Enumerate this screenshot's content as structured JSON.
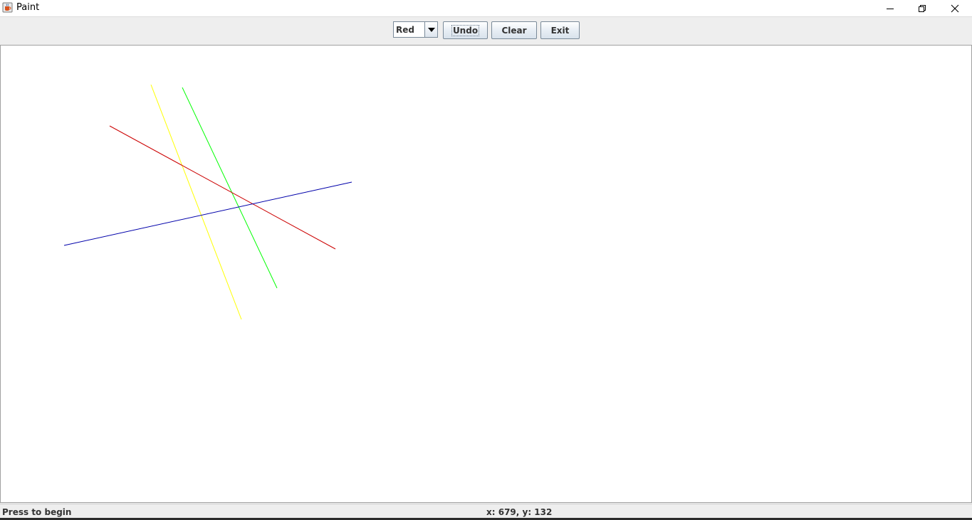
{
  "window": {
    "title": "Paint",
    "app_icon": "java-coffee-icon",
    "controls": {
      "minimize_icon": "minimize-icon",
      "maximize_icon": "restore-icon",
      "close_icon": "close-icon"
    }
  },
  "toolbar": {
    "color_select": {
      "selected": "Red",
      "arrow_icon": "chevron-down-icon"
    },
    "undo_label": "Undo",
    "clear_label": "Clear",
    "exit_label": "Exit"
  },
  "canvas": {
    "background": "#ffffff",
    "lines": [
      {
        "color": "#ffff00",
        "name": "yellow-line"
      },
      {
        "color": "#00ff00",
        "name": "green-line"
      },
      {
        "color": "#cc0000",
        "name": "red-line"
      },
      {
        "color": "#0000aa",
        "name": "blue-line"
      }
    ]
  },
  "status": {
    "message": "Press to begin",
    "coordinates": "x: 679, y: 132"
  }
}
